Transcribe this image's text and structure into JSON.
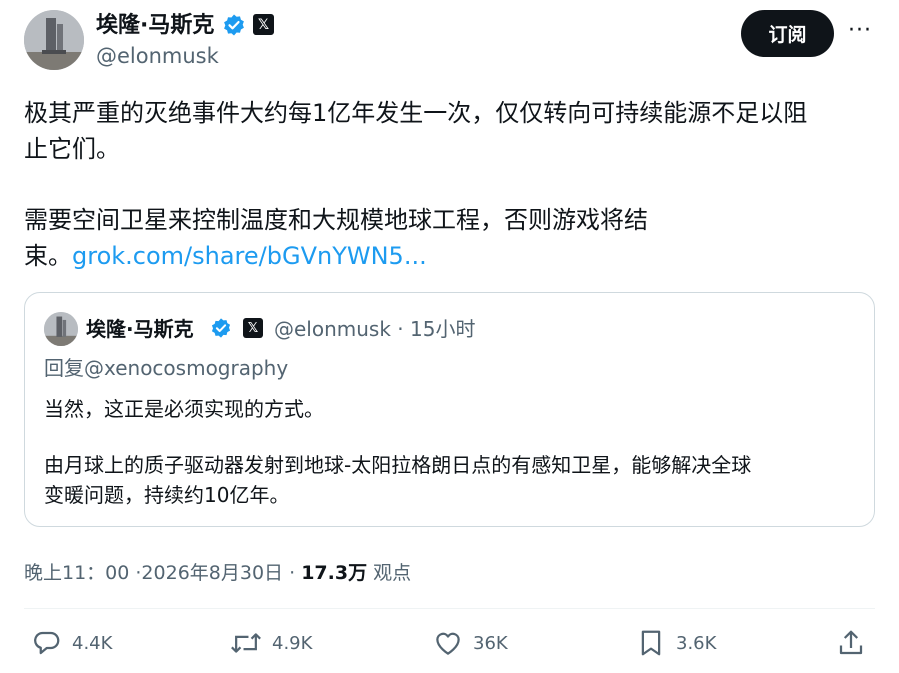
{
  "author": {
    "display_name": "埃隆·马斯克",
    "handle": "@elonmusk",
    "follow_label": "订阅",
    "more_label": "···"
  },
  "post": {
    "paragraph1": "极其严重的灭绝事件大约每1亿年发生一次，仅仅转向可持续能源不足以阻止它们。",
    "paragraph1_line1": "极其严重的灭绝事件大约每1亿年发生一次，仅仅转向可持续能源不足以阻",
    "paragraph1_line2": "止它们。",
    "paragraph2_line1": "需要空间卫星来控制温度和大规模地球工程，否则游戏将结",
    "paragraph2_line2_text": "束。",
    "link_text": "grok.com/share/bGVnYWN5..."
  },
  "quote": {
    "display_name": "埃隆·马斯克",
    "handle": "@elonmusk",
    "time": "· 15小时",
    "reply_to": "回复@xenocosmography",
    "line1": "当然，这正是必须实现的方式。",
    "line2": "由月球上的质子驱动器发射到地球-太阳拉格朗日点的有感知卫星，能够解决全球",
    "line3": "变暖问题，持续约10亿年。"
  },
  "meta": {
    "time": "晚上11：00 ·2026年8月30日 ·",
    "views_count": "17.3万",
    "views_label": "观点"
  },
  "actions": {
    "replies": "4.4K",
    "reposts": "4.9K",
    "likes": "36K",
    "bookmarks": "3.6K"
  },
  "colors": {
    "text": "#0f1419",
    "secondary": "#536471",
    "link": "#1d9bf0",
    "verified": "#1d9bf0",
    "border": "#cfd9de"
  }
}
